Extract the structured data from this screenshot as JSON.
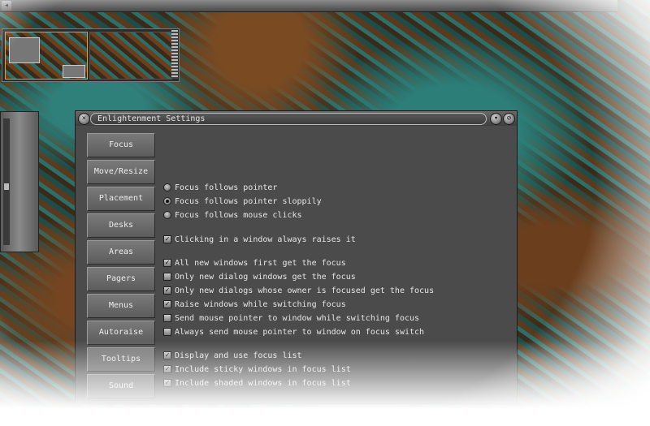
{
  "topbar": {
    "button_icon": "arrow-icon"
  },
  "window": {
    "title": "Enlightenment Settings"
  },
  "tabs": [
    {
      "label": "Focus"
    },
    {
      "label": "Move/Resize"
    },
    {
      "label": "Placement"
    },
    {
      "label": "Desks"
    },
    {
      "label": "Areas"
    },
    {
      "label": "Pagers"
    },
    {
      "label": "Menus"
    },
    {
      "label": "Autoraise"
    },
    {
      "label": "Tooltips"
    },
    {
      "label": "Sound"
    }
  ],
  "focus_mode": {
    "options": [
      {
        "label": "Focus follows pointer",
        "selected": false
      },
      {
        "label": "Focus follows pointer sloppily",
        "selected": true
      },
      {
        "label": "Focus follows mouse clicks",
        "selected": false
      }
    ]
  },
  "checks": [
    {
      "label": "Clicking in a window always raises it",
      "checked": true
    },
    {
      "label": "All new windows first get the focus",
      "checked": true
    },
    {
      "label": "Only new dialog windows get the focus",
      "checked": false
    },
    {
      "label": "Only new dialogs whose owner is focused get the focus",
      "checked": true
    },
    {
      "label": "Raise windows while switching focus",
      "checked": true
    },
    {
      "label": "Send mouse pointer to window while switching focus",
      "checked": false
    },
    {
      "label": "Always send mouse pointer to window on focus switch",
      "checked": false
    },
    {
      "label": "Display and use focus list",
      "checked": true
    },
    {
      "label": "Include sticky windows in focus list",
      "checked": true
    },
    {
      "label": "Include shaded windows in focus list",
      "checked": true
    }
  ]
}
